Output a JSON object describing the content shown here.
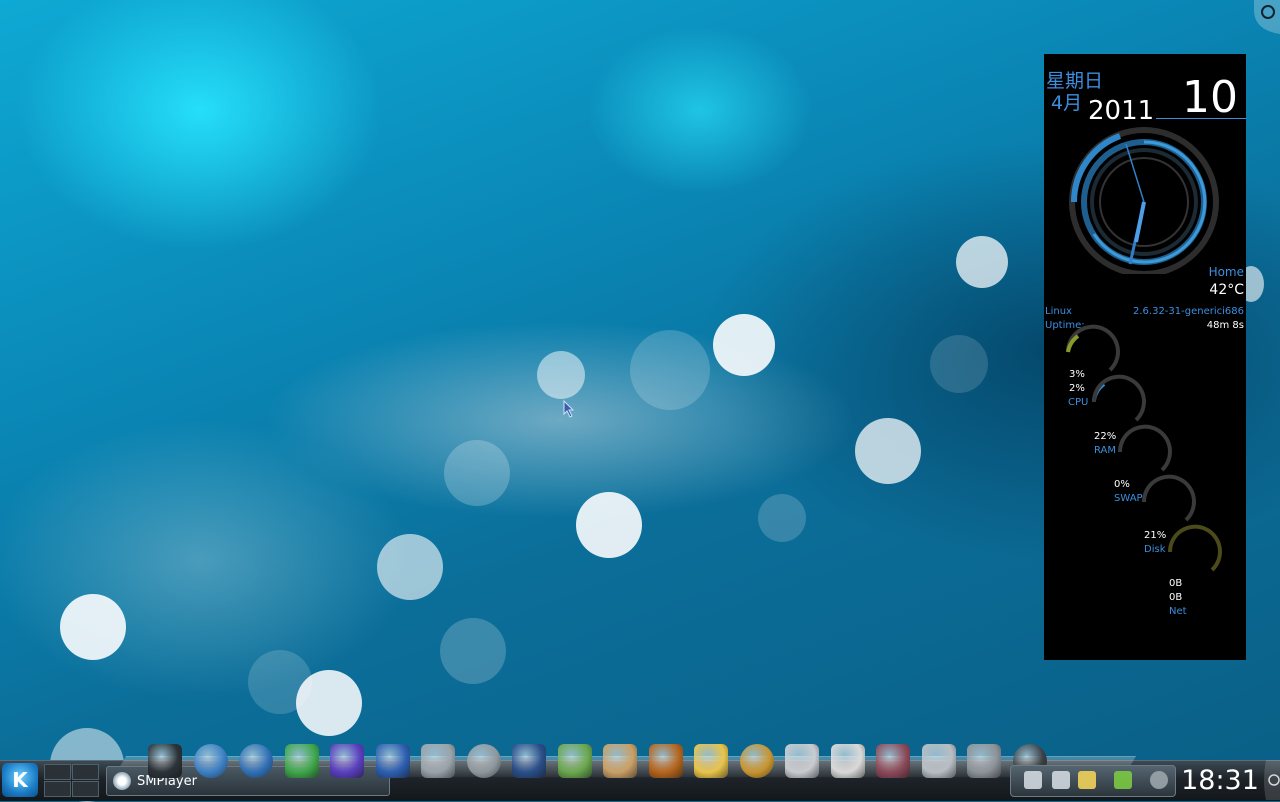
{
  "widget": {
    "weekday": "星期日",
    "month": "4月",
    "year": "2011",
    "day": "10",
    "location": "Home",
    "temperature": "42°C",
    "os_label": "Linux",
    "kernel": "2.6.32-31-generici686",
    "uptime_label": "Uptime:",
    "uptime_value": "48m 8s",
    "cpu1": "3%",
    "cpu2": "2%",
    "cpu_label": "CPU",
    "ram_value": "22%",
    "ram_label": "RAM",
    "swap_value": "0%",
    "swap_label": "SWAP",
    "disk_value": "21%",
    "disk_label": "Disk",
    "net_down": "0B",
    "net_up": "0B",
    "net_label": "Net",
    "levels": {
      "cpu": 0.03,
      "ram": 0.22,
      "swap": 0.0,
      "disk": 0.21
    }
  },
  "taskbar": {
    "task_label": "SMPlayer",
    "clock": "18:31"
  },
  "dock": [
    {
      "name": "terminal-icon",
      "color": "#2c3338"
    },
    {
      "name": "compass-browser-icon",
      "color": "#3b7fc4"
    },
    {
      "name": "internet-explorer-icon",
      "color": "#2f6fb5"
    },
    {
      "name": "messenger-people-icon",
      "color": "#3fa74b"
    },
    {
      "name": "wizard-icon",
      "color": "#5a3fbf"
    },
    {
      "name": "clapperboard-icon",
      "color": "#2d5fb0"
    },
    {
      "name": "film-reel-icon",
      "color": "#9aa3aa"
    },
    {
      "name": "silver-sphere-icon",
      "color": "#8e979d"
    },
    {
      "name": "activity-monitor-icon",
      "color": "#2a4f8a"
    },
    {
      "name": "text-editor-pen-icon",
      "color": "#6aa84f"
    },
    {
      "name": "photo-viewer-icon",
      "color": "#c9a066"
    },
    {
      "name": "photo-stack-icon",
      "color": "#b5651d"
    },
    {
      "name": "sticky-note-icon",
      "color": "#e8c44b"
    },
    {
      "name": "compass-gold-icon",
      "color": "#c7942f"
    },
    {
      "name": "mail-envelope-icon",
      "color": "#c8ccd0"
    },
    {
      "name": "documents-icon",
      "color": "#d9d9d9"
    },
    {
      "name": "workspace-switcher-icon",
      "color": "#8c4a5a"
    },
    {
      "name": "email-at-icon",
      "color": "#b7bec4"
    },
    {
      "name": "system-settings-icon",
      "color": "#8c9399"
    },
    {
      "name": "power-icon",
      "color": "#3a3f44"
    }
  ],
  "tray": [
    "network-icon",
    "volume-icon",
    "clipboard-icon",
    "battery-power-icon",
    "info-icon"
  ]
}
